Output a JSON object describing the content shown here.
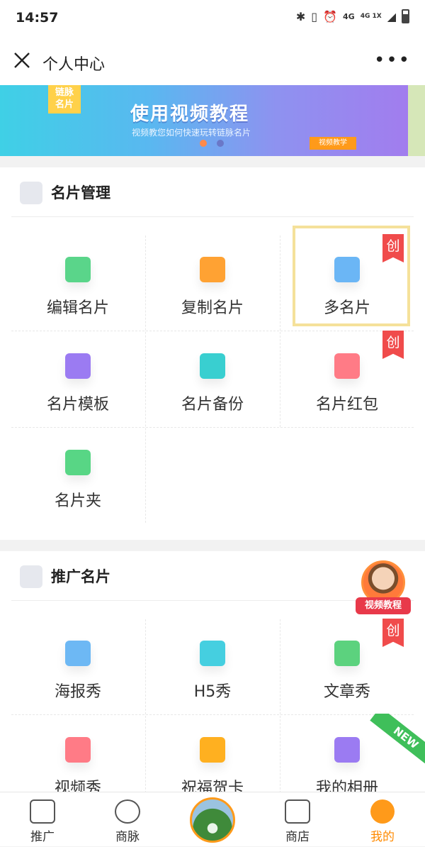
{
  "status_bar": {
    "time": "14:57",
    "indicators": [
      "bluetooth-icon",
      "vibrate-icon",
      "alarm-icon",
      "4G",
      "4G 1X",
      "signal-icon",
      "battery-icon"
    ]
  },
  "titlebar": {
    "title": "个人中心"
  },
  "banner": {
    "logo_line1": "链脉",
    "logo_line2": "名片",
    "title": "使用视频教程",
    "subtitle": "视频教您如何快速玩转链脉名片",
    "tag": "视频教学"
  },
  "card_management": {
    "title": "名片管理",
    "items": [
      {
        "label": "编辑名片",
        "icon": "edit-card-icon",
        "color": "#5ad58a"
      },
      {
        "label": "复制名片",
        "icon": "copy-card-icon",
        "color": "#ffa233"
      },
      {
        "label": "多名片",
        "icon": "multi-card-icon",
        "color": "#6bb6f5",
        "badge": "创"
      },
      {
        "label": "名片模板",
        "icon": "template-icon",
        "color": "#9b7bf2"
      },
      {
        "label": "名片备份",
        "icon": "backup-layers-icon",
        "color": "#39cfd0"
      },
      {
        "label": "名片红包",
        "icon": "red-envelope-icon",
        "color": "#ff7b86",
        "badge": "创"
      },
      {
        "label": "名片夹",
        "icon": "folder-icon",
        "color": "#58d685"
      }
    ]
  },
  "promotion": {
    "title": "推广名片",
    "items": [
      {
        "label": "海报秀",
        "icon": "poster-image-icon",
        "color": "#6db8f4"
      },
      {
        "label": "H5秀",
        "icon": "html5-icon",
        "color": "#45cfe0"
      },
      {
        "label": "文章秀",
        "icon": "article-doc-icon",
        "color": "#5cd27e",
        "badge": "创"
      },
      {
        "label": "视频秀",
        "icon": "video-play-icon",
        "color": "#ff7b86"
      },
      {
        "label": "祝福贺卡",
        "icon": "greeting-card-icon",
        "color": "#ffb020"
      },
      {
        "label": "我的相册",
        "icon": "photo-album-icon",
        "color": "#9b7bf2",
        "ribbon": "NEW"
      }
    ]
  },
  "floating_tutorial": {
    "label": "视频教程"
  },
  "tabbar": {
    "items": [
      {
        "label": "推广",
        "icon": "promote-icon"
      },
      {
        "label": "商脉",
        "icon": "network-circle-icon"
      },
      {
        "label": "",
        "icon": "profile-avatar-icon"
      },
      {
        "label": "商店",
        "icon": "shop-icon"
      },
      {
        "label": "我的",
        "icon": "me-smile-icon",
        "active": true
      }
    ],
    "accent": "#ff8a00"
  }
}
